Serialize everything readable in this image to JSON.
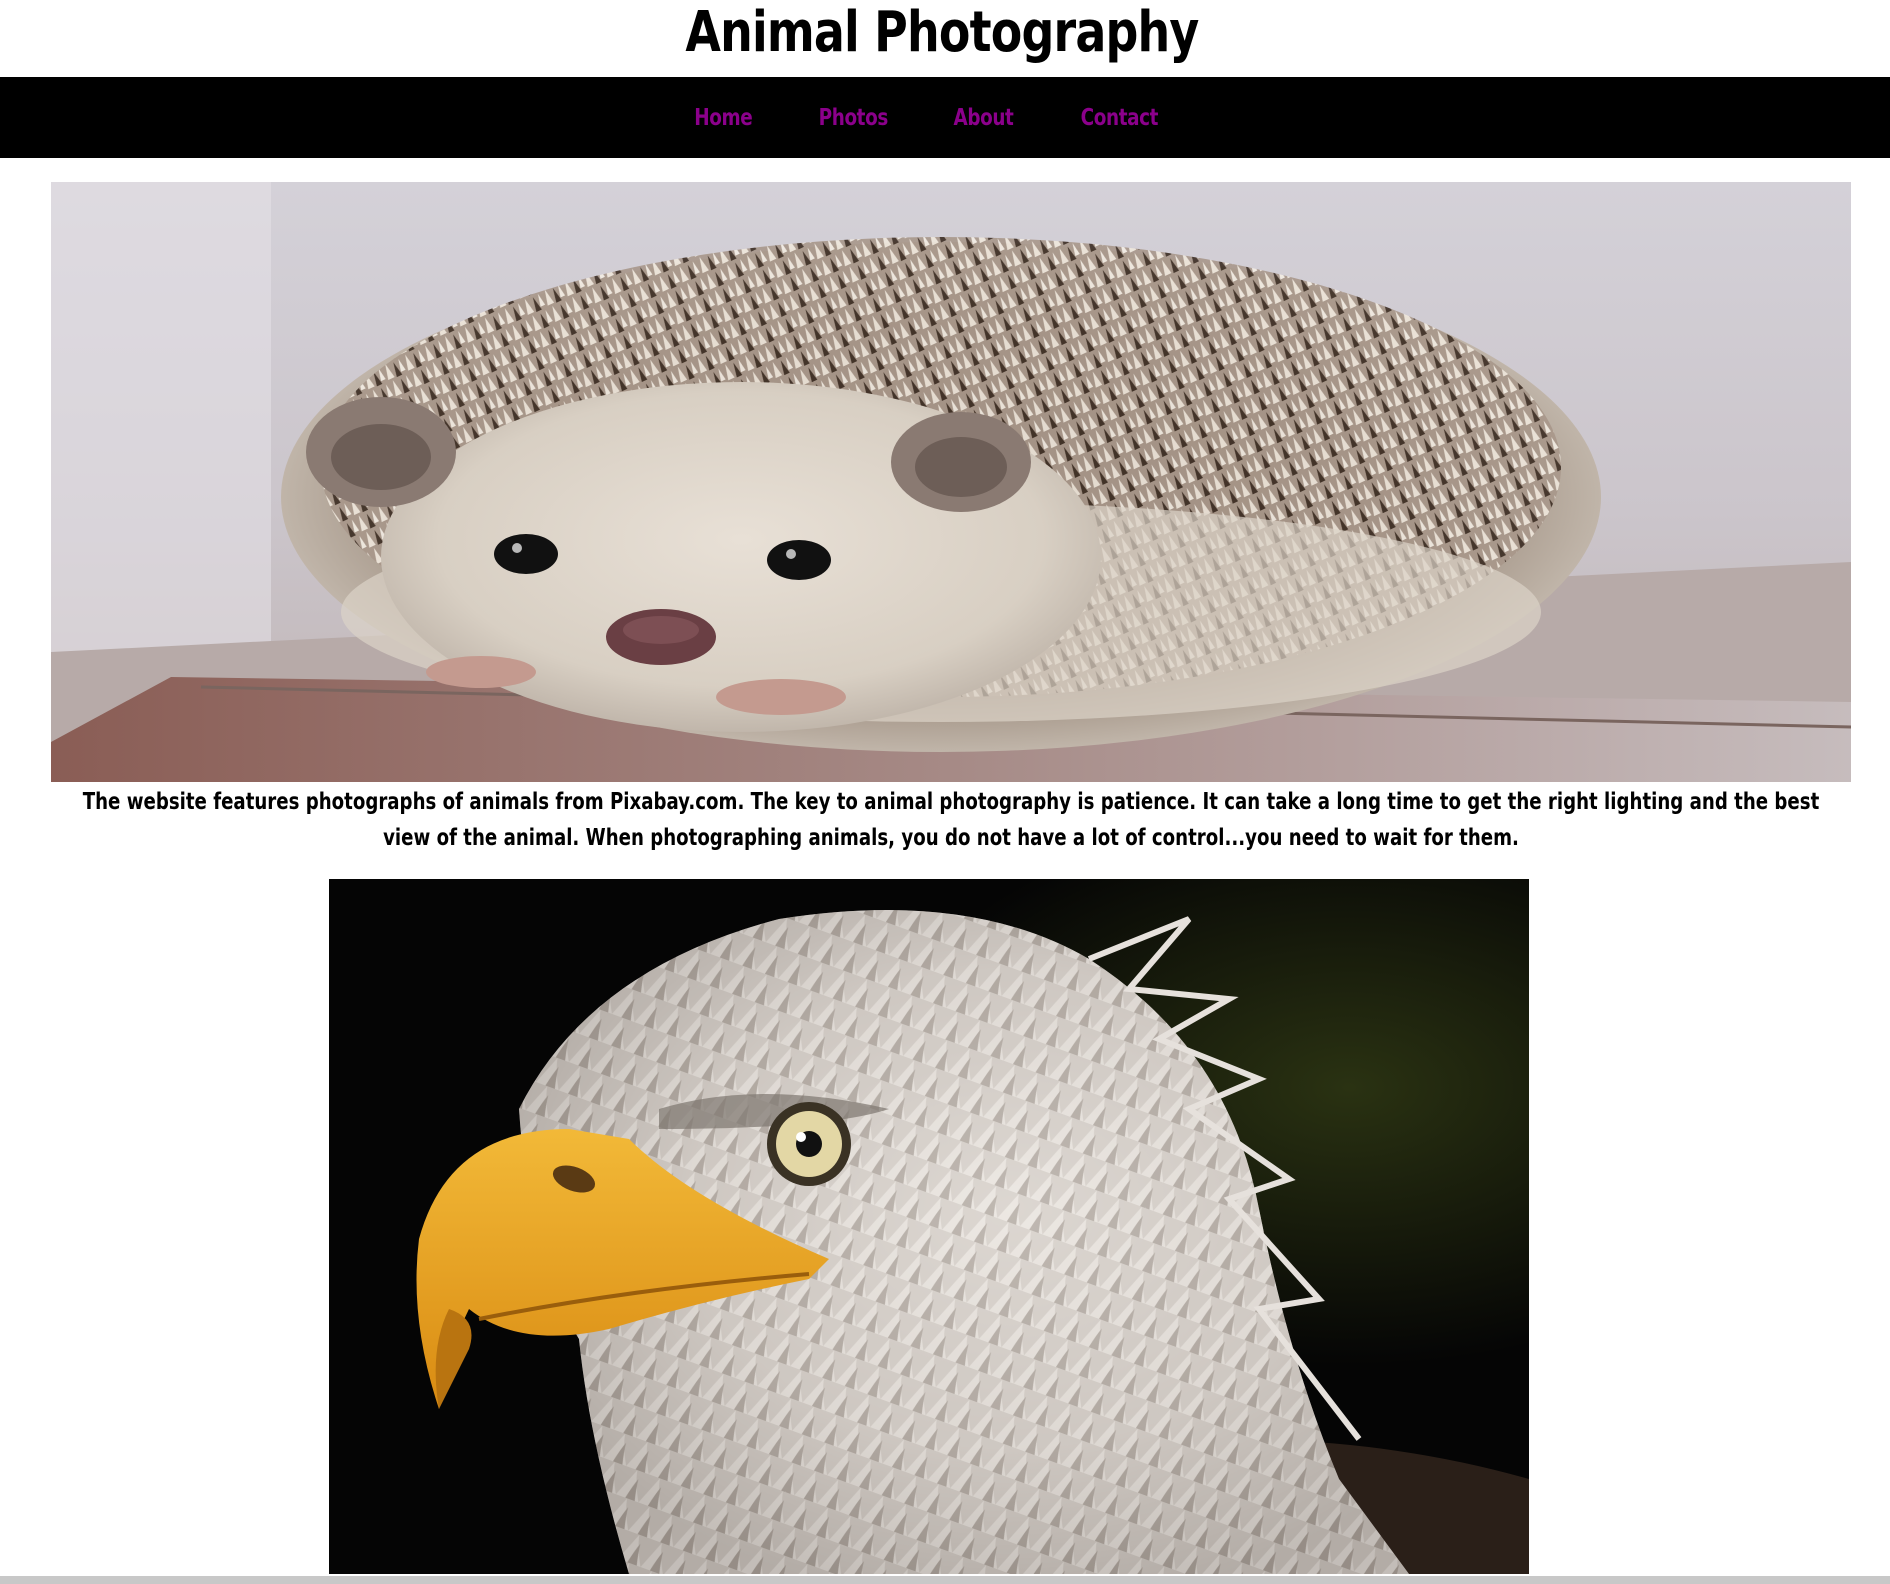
{
  "header": {
    "title": "Animal Photography"
  },
  "nav": {
    "items": [
      {
        "label": "Home"
      },
      {
        "label": "Photos"
      },
      {
        "label": "About"
      },
      {
        "label": "Contact"
      }
    ],
    "link_color": "#8b008b",
    "background": "#000000"
  },
  "main": {
    "intro_text": "The website features photographs of animals from Pixabay.com. The key to animal photography is patience. It can take a long time to get the right lighting and the best view of the animal. When photographing animals, you do not have a lot of control...you need to wait for them.",
    "images": [
      {
        "subject": "hedgehog"
      },
      {
        "subject": "bald eagle"
      }
    ]
  }
}
